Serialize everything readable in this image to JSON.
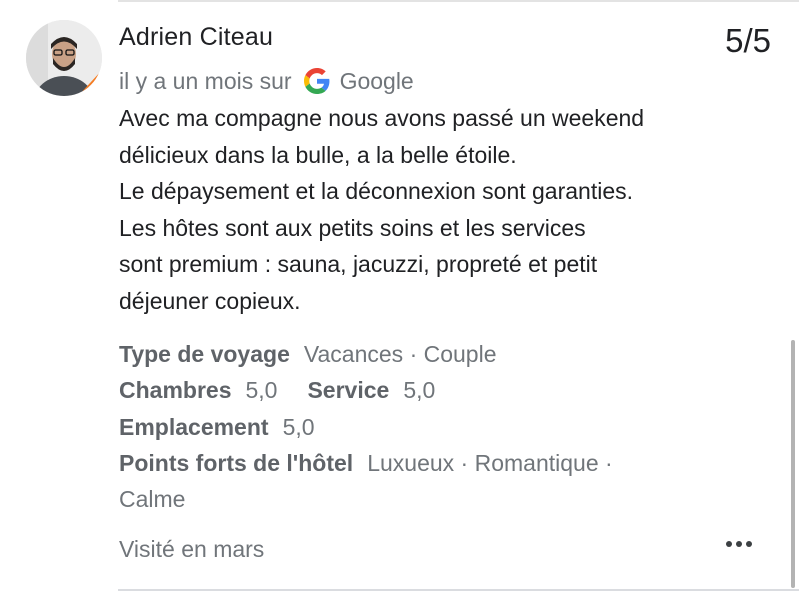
{
  "review": {
    "author": "Adrien Citeau",
    "rating": "5/5",
    "posted": "il y a un mois sur",
    "source": "Google",
    "text_lines": [
      "Avec ma compagne nous avons passé un weekend",
      "délicieux dans la bulle, a la belle étoile.",
      "Le dépaysement et la déconnexion sont garanties.",
      "Les hôtes sont aux petits soins et les services",
      "sont premium : sauna, jacuzzi, propreté et petit",
      "déjeuner copieux."
    ],
    "details": {
      "trip_type_label": "Type de voyage",
      "trip_type_value": "Vacances · Couple",
      "rooms_label": "Chambres",
      "rooms_value": "5,0",
      "service_label": "Service",
      "service_value": "5,0",
      "location_label": "Emplacement",
      "location_value": "5,0",
      "highlights_label": "Points forts de l'hôtel",
      "highlights_value_line1": "Luxueux · Romantique ·",
      "highlights_value_line2": "Calme"
    },
    "visited": "Visité en mars"
  },
  "icons": {
    "source": "google-g-icon",
    "more": "more-options-icon"
  },
  "colors": {
    "google_blue": "#4285F4",
    "google_red": "#EA4335",
    "google_yellow": "#FBBC05",
    "google_green": "#34A853",
    "secondary_text": "#70757a",
    "label_text": "#5f6368"
  }
}
